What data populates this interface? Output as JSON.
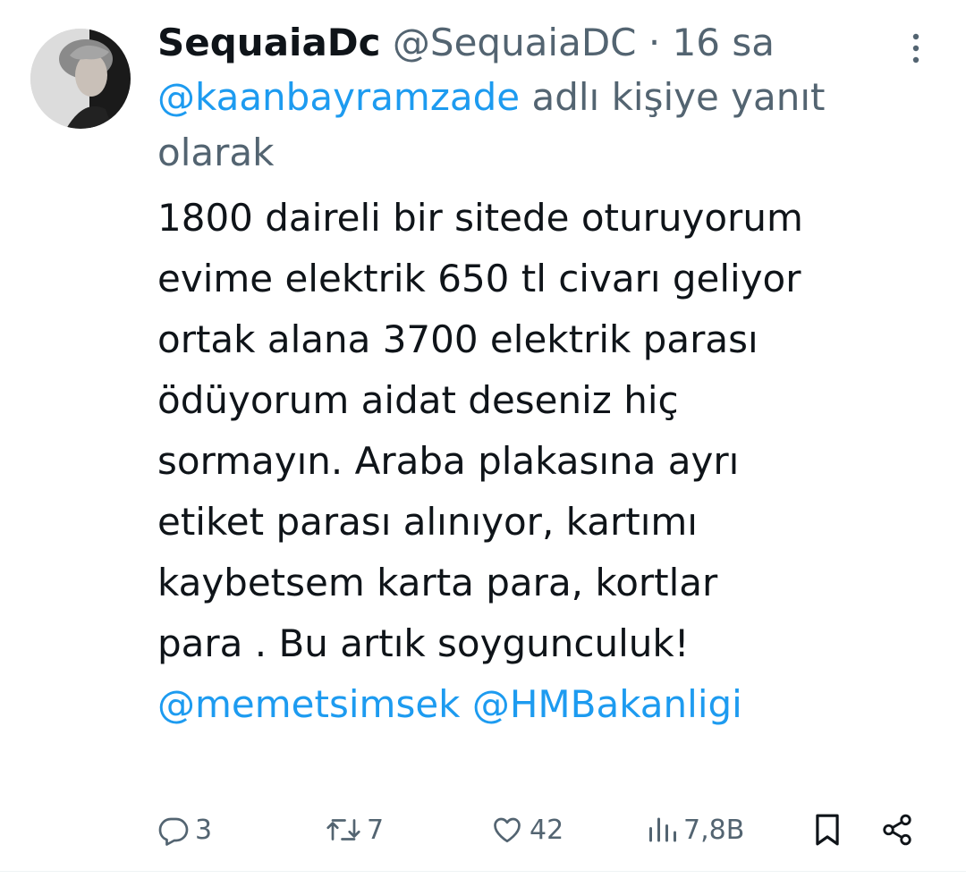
{
  "author": {
    "display_name": "SequaiaDc",
    "handle": "@SequaiaDC",
    "separator": "·",
    "time": "16 sa"
  },
  "reply_context": {
    "mention": "@kaanbayramzade",
    "suffix": " adlı kişiye yanıt olarak"
  },
  "body": {
    "lines": [
      "1800 daireli bir sitede oturuyorum",
      "evime elektrik 650 tl civarı geliyor",
      "ortak alana 3700 elektrik parası",
      "ödüyorum aidat deseniz hiç",
      "sormayın. Araba plakasına ayrı",
      "etiket parası alınıyor, kartımı",
      "kaybetsem karta para, kortlar",
      "para . Bu artık soygunculuk!"
    ],
    "mentions": [
      "@memetsimsek",
      "@HMBakanligi"
    ]
  },
  "actions": {
    "replies": "3",
    "retweets": "7",
    "likes": "42",
    "views": "7,8B"
  },
  "icons": {
    "more": "more-vertical-icon",
    "reply": "reply-icon",
    "retweet": "retweet-icon",
    "like": "heart-icon",
    "views": "views-icon",
    "bookmark": "bookmark-icon",
    "share": "share-icon"
  },
  "colors": {
    "text": "#0f1419",
    "secondary": "#536471",
    "link": "#1d9bf0"
  }
}
